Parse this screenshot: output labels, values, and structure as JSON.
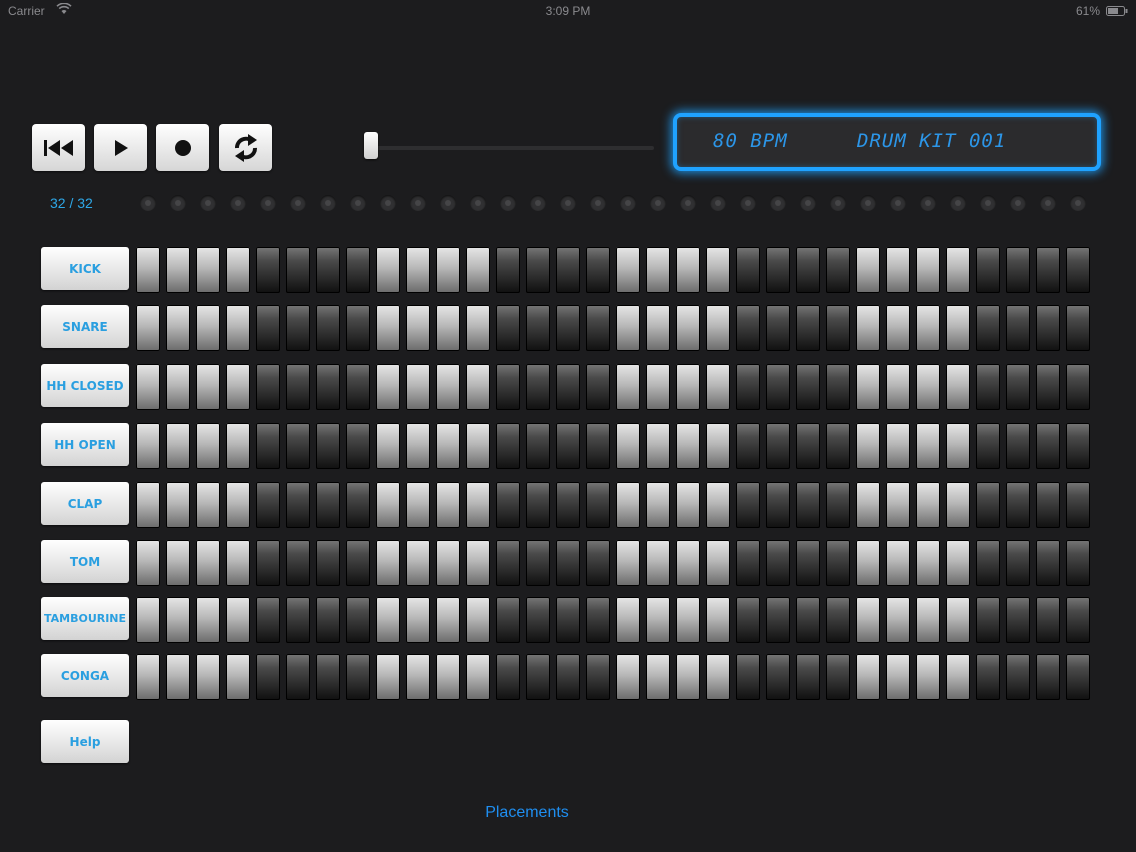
{
  "status_bar": {
    "carrier": "Carrier",
    "time": "3:09 PM",
    "battery": "61%"
  },
  "transport": {
    "buttons": [
      {
        "name": "rewind-button",
        "icon": "rewind-icon"
      },
      {
        "name": "play-button",
        "icon": "play-icon"
      },
      {
        "name": "record-button",
        "icon": "record-icon"
      },
      {
        "name": "loop-button",
        "icon": "loop-icon"
      }
    ],
    "tempo_slider_level": 0.0
  },
  "display": {
    "bpm": "80 BPM",
    "kit": "DRUM KIT 001",
    "accent": "#1fa2ff"
  },
  "step_counter": "32 / 32",
  "steps": 32,
  "instruments": [
    "KICK",
    "SNARE",
    "HH CLOSED",
    "HH OPEN",
    "CLAP",
    "TOM",
    "TAMBOURINE",
    "CONGA"
  ],
  "help_label": "Help",
  "footer_link": "Placements",
  "colors": {
    "background": "#1c1c1e",
    "label_blue": "#2a9fe0",
    "link_blue": "#1f8ef0"
  }
}
